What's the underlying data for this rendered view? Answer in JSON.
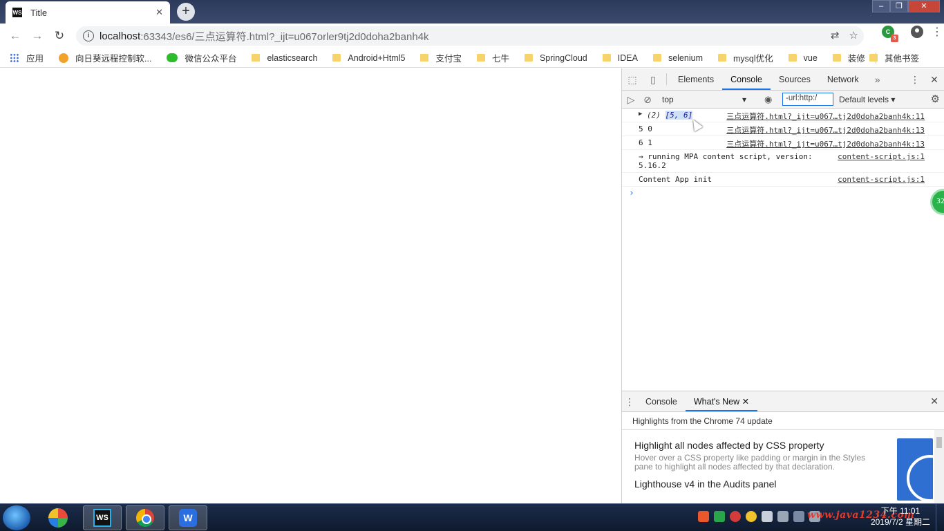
{
  "browser": {
    "tab_title": "Title",
    "tab_favicon": "WS",
    "url_host": "localhost",
    "url_path": ":63343/es6/三点运算符.html?_ijt=u067orler9tj2d0doha2banh4k",
    "extension_badge": "3",
    "extension_label": "C"
  },
  "bookmarks": {
    "items": [
      {
        "label": "应用",
        "icon": "apps-icon"
      },
      {
        "label": "向日葵远程控制软...",
        "icon": "sunflower-icon"
      },
      {
        "label": "微信公众平台",
        "icon": "wechat-icon"
      },
      {
        "label": "elasticsearch",
        "icon": "folder-icon"
      },
      {
        "label": "Android+Html5",
        "icon": "folder-icon"
      },
      {
        "label": "支付宝",
        "icon": "folder-icon"
      },
      {
        "label": "七牛",
        "icon": "folder-icon"
      },
      {
        "label": "SpringCloud",
        "icon": "folder-icon"
      },
      {
        "label": "IDEA",
        "icon": "folder-icon"
      },
      {
        "label": "selenium",
        "icon": "folder-icon"
      },
      {
        "label": "mysql优化",
        "icon": "folder-icon"
      },
      {
        "label": "vue",
        "icon": "folder-icon"
      },
      {
        "label": "装修",
        "icon": "folder-icon"
      }
    ],
    "other": "其他书签"
  },
  "devtools": {
    "tabs": [
      "Elements",
      "Console",
      "Sources",
      "Network"
    ],
    "active_tab": "Console",
    "context": "top",
    "filter_value": "-url:http:/",
    "levels": "Default levels",
    "console": [
      {
        "count": "(2)",
        "value": "[5, 6]",
        "source": "三点运算符.html?_ijt=u067…tj2d0doha2banh4k:11"
      },
      {
        "text": "5 0",
        "source": "三点运算符.html?_ijt=u067…tj2d0doha2banh4k:13"
      },
      {
        "text": "6 1",
        "source": "三点运算符.html?_ijt=u067…tj2d0doha2banh4k:13"
      },
      {
        "text": "→ running MPA content script, version:",
        "text2": "5.16.2",
        "source": "content-script.js:1"
      },
      {
        "text": "Content App init",
        "source": "content-script.js:1"
      }
    ],
    "side_badge": "32",
    "drawer": {
      "tabs": [
        "Console",
        "What's New"
      ],
      "active_tab": "What's New",
      "heading": "Highlights from the Chrome 74 update",
      "news": [
        {
          "title": "Highlight all nodes affected by CSS property",
          "desc": "Hover over a CSS property like padding or margin in the Styles pane to highlight all nodes affected by that declaration."
        },
        {
          "title": "Lighthouse v4 in the Audits panel"
        }
      ]
    }
  },
  "taskbar": {
    "time": "下午 11:01",
    "date": "2019/7/2 星期二",
    "watermark": "www.java1234.com",
    "apps": [
      "ws-icon",
      "chrome-icon",
      "wps-icon"
    ]
  }
}
